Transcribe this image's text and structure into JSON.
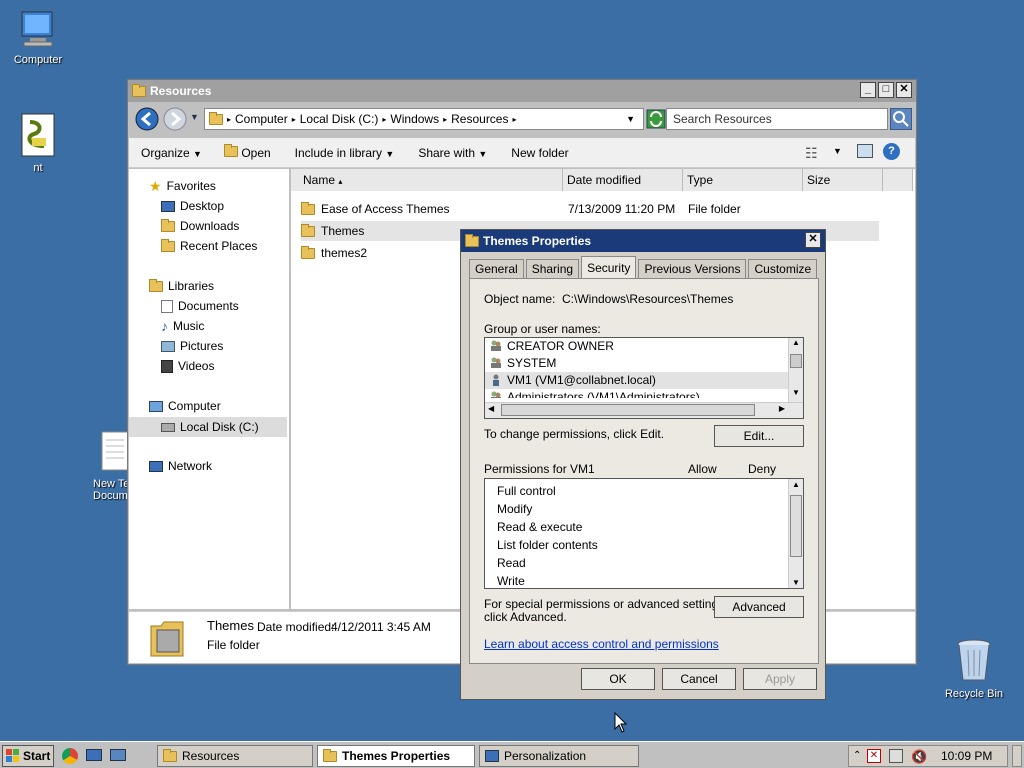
{
  "desktop": {
    "icons": {
      "computer": "Computer",
      "nt": "nt",
      "newtext": "New Te…\nDocume…",
      "recycle": "Recycle Bin"
    }
  },
  "explorer": {
    "title": "Resources",
    "breadcrumb": [
      "Computer",
      "Local Disk (C:)",
      "Windows",
      "Resources"
    ],
    "search_placeholder": "Search Resources",
    "toolbar": {
      "organize": "Organize",
      "open": "Open",
      "include": "Include in library",
      "share": "Share with",
      "newfolder": "New folder"
    },
    "nav": {
      "favorites": "Favorites",
      "desktop": "Desktop",
      "downloads": "Downloads",
      "recent": "Recent Places",
      "libraries": "Libraries",
      "documents": "Documents",
      "music": "Music",
      "pictures": "Pictures",
      "videos": "Videos",
      "computer": "Computer",
      "localdisk": "Local Disk (C:)",
      "network": "Network"
    },
    "columns": {
      "name": "Name",
      "date": "Date modified",
      "type": "Type",
      "size": "Size"
    },
    "rows": [
      {
        "name": "Ease of Access Themes",
        "date": "7/13/2009 11:20 PM",
        "type": "File folder"
      },
      {
        "name": "Themes",
        "date": "",
        "type": ""
      },
      {
        "name": "themes2",
        "date": "",
        "type": ""
      }
    ],
    "details": {
      "name": "Themes",
      "date_label": "Date modified:",
      "date_value": "4/12/2011 3:45 AM",
      "type": "File folder"
    }
  },
  "dialog": {
    "title": "Themes Properties",
    "tabs": [
      "General",
      "Sharing",
      "Security",
      "Previous Versions",
      "Customize"
    ],
    "object_label": "Object name:",
    "object_value": "C:\\Windows\\Resources\\Themes",
    "group_label": "Group or user names:",
    "users": [
      "CREATOR OWNER",
      "SYSTEM",
      "VM1 (VM1@collabnet.local)",
      "Administrators (VM1\\Administrators)"
    ],
    "change_text": "To change permissions, click Edit.",
    "edit_button": "Edit...",
    "perm_label": "Permissions for VM1",
    "allow": "Allow",
    "deny": "Deny",
    "permissions": [
      "Full control",
      "Modify",
      "Read & execute",
      "List folder contents",
      "Read",
      "Write"
    ],
    "special_text_1": "For special permissions or advanced settings,",
    "special_text_2": "click Advanced.",
    "advanced_button": "Advanced",
    "link": "Learn about access control and permissions",
    "ok": "OK",
    "cancel": "Cancel",
    "apply": "Apply"
  },
  "taskbar": {
    "start": "Start",
    "tasks": [
      "Resources",
      "Themes Properties",
      "Personalization"
    ],
    "clock": "10:09 PM"
  }
}
